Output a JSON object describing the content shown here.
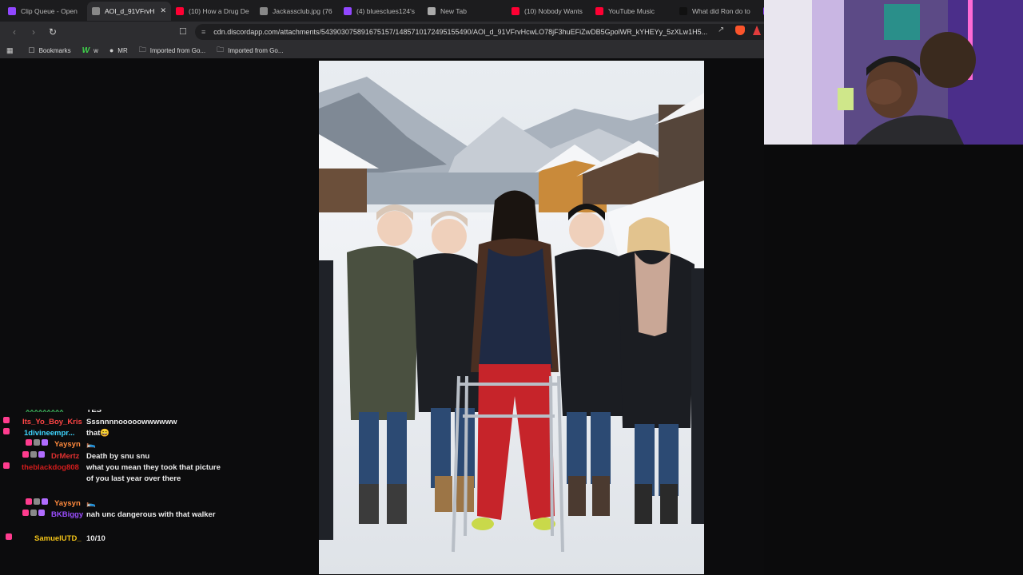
{
  "tabs": [
    {
      "label": "Clip Queue - Open",
      "icon": "twitch-icon",
      "color": "#9147ff",
      "active": false
    },
    {
      "label": "AOI_d_91VFrvH",
      "icon": "globe-icon",
      "color": "#888888",
      "active": true
    },
    {
      "label": "(10) How a Drug De",
      "icon": "youtube-icon",
      "color": "#ff0033",
      "active": false
    },
    {
      "label": "Jackassclub.jpg (76",
      "icon": "globe-icon",
      "color": "#888888",
      "active": false
    },
    {
      "label": "(4) bluesclues124's",
      "icon": "twitch-icon",
      "color": "#9147ff",
      "active": false
    },
    {
      "label": "New Tab",
      "icon": "brave-shield-icon",
      "color": "#aaaaaa",
      "active": false
    },
    {
      "label": "(10) Nobody Wants",
      "icon": "youtube-icon",
      "color": "#ff0033",
      "active": false
    },
    {
      "label": "YouTube Music",
      "icon": "youtube-music-icon",
      "color": "#ff0033",
      "active": false
    },
    {
      "label": "What did Ron do to",
      "icon": "tiktok-icon",
      "color": "#111111",
      "active": false
    },
    {
      "label": "",
      "icon": "twitch-icon",
      "color": "#9147ff",
      "active": false
    }
  ],
  "toolbar": {
    "url": "cdn.discordapp.com/attachments/543903075891675157/1485710172495155490/AOI_d_91VFrvHcwLO78jF3huEFiZwDB5GpolWR_kYHEYy_5zXLw1H5..."
  },
  "bookmarks": [
    {
      "label": "Bookmarks",
      "icon": "bookmark-icon"
    },
    {
      "label": "w",
      "icon": "w-logo-icon"
    },
    {
      "label": "MR",
      "icon": "mr-icon"
    },
    {
      "label": "Imported from Go...",
      "icon": "folder-icon"
    },
    {
      "label": "Imported from Go...",
      "icon": "folder-icon"
    }
  ],
  "chat": {
    "partial_top": "YES",
    "messages": [
      {
        "user": "Its_Yo_Boy_Kris",
        "color": "#ff4545",
        "text": "Sssnnnnooooowwwwww"
      },
      {
        "user": "1divineempr...",
        "color": "#3fd6ff",
        "text": "that😄"
      },
      {
        "user": "Yaysyn",
        "color": "#ff8a3d",
        "text": "🛌"
      },
      {
        "user": "DrMertz",
        "color": "#e03030",
        "text": "Death by snu snu"
      },
      {
        "user": "theblackdog808",
        "color": "#d21c1c",
        "text": "what you mean they took that picture of you last year over there"
      },
      {
        "user": "Yaysyn",
        "color": "#ff8a3d",
        "text": "🛌"
      },
      {
        "user": "BKBiggy",
        "color": "#9b4dff",
        "text": "nah unc dangerous with that walker"
      },
      {
        "user": "SamuelUTD_",
        "color": "#f5c518",
        "text": "10/10"
      }
    ]
  }
}
